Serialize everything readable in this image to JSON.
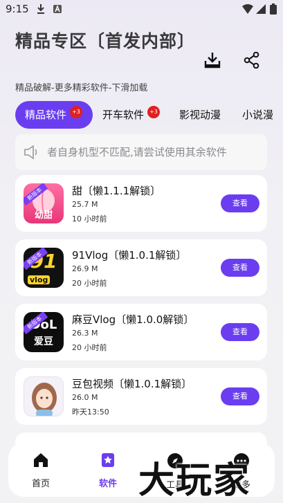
{
  "status_bar": {
    "time": "9:15"
  },
  "header": {
    "title": "精品专区〔首发内部〕",
    "subtitle": "精品破解-更多精彩软件-下滑加载"
  },
  "tabs": [
    {
      "label": "精品软件",
      "badge": "+3"
    },
    {
      "label": "开车软件",
      "badge": "+3"
    },
    {
      "label": "影视动漫"
    },
    {
      "label": "小说漫"
    }
  ],
  "notice": {
    "text": "者自身机型不匹配,请尝试使用其余软件"
  },
  "apps": [
    {
      "name": "甜〔懒1.1.1解锁〕",
      "size": "25.7 M",
      "time": "10 小时前",
      "button": "查看",
      "icon_text": "幼甜",
      "ribbon": "新版本"
    },
    {
      "name": "91Vlog〔懒1.0.1解锁〕",
      "size": "26.9 M",
      "time": "20 小时前",
      "button": "查看",
      "icon_text": "91",
      "icon_sub": "vlog",
      "ribbon": "新版本"
    },
    {
      "name": "麻豆Vlog〔懒1.0.0解锁〕",
      "size": "26.3 M",
      "time": "20 小时前",
      "button": "查看",
      "icon_text": "DoL",
      "icon_sub": "爱豆",
      "ribbon": "新版本"
    },
    {
      "name": "豆包视频〔懒1.0.1解锁〕",
      "size": "26.0 M",
      "time": "昨天13:50",
      "button": "查看"
    }
  ],
  "nav": [
    {
      "label": "首页"
    },
    {
      "label": "软件"
    },
    {
      "label": "工具"
    },
    {
      "label": "更多"
    }
  ],
  "watermark": "大玩家",
  "colors": {
    "accent": "#6a3ef0",
    "badge": "#e02020"
  }
}
